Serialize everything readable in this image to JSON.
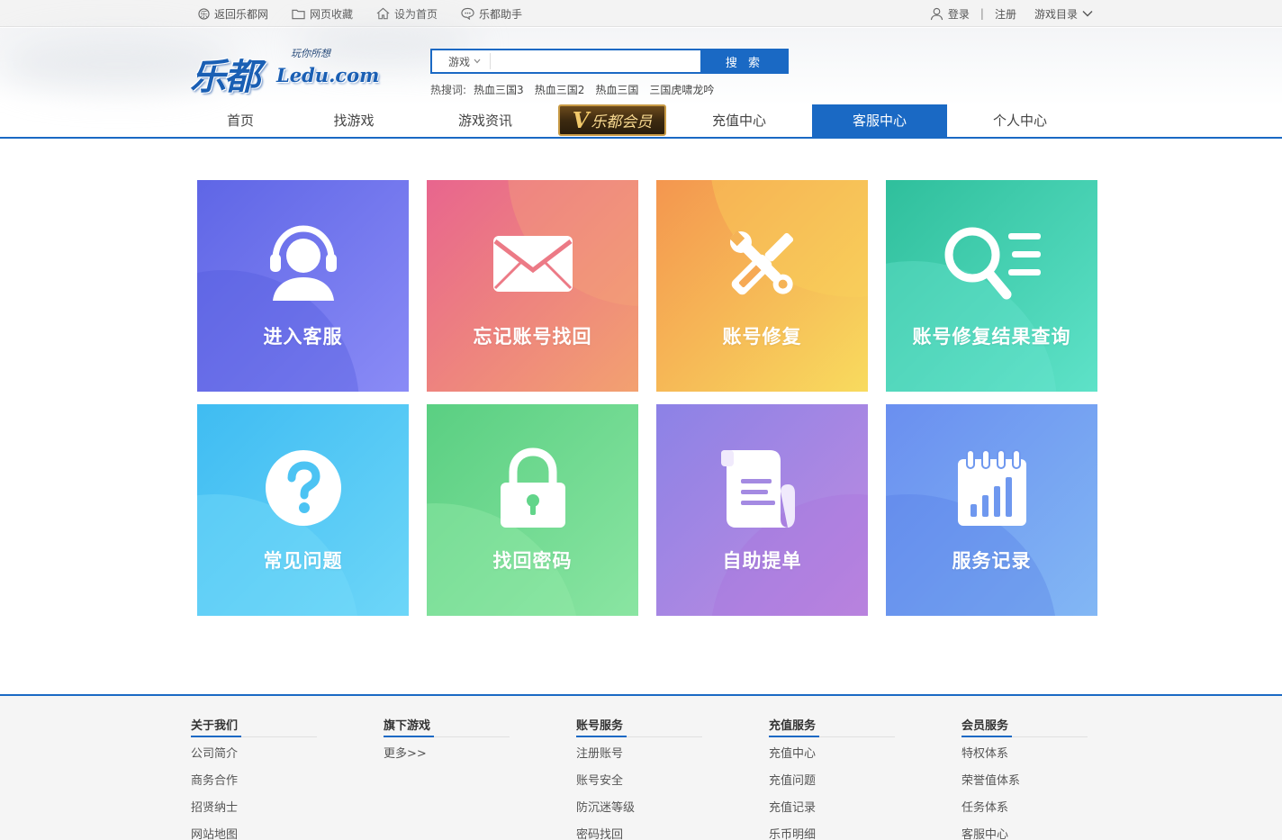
{
  "topbar": {
    "left_items": [
      {
        "label": "返回乐都网",
        "icon": "ledu-coin-icon"
      },
      {
        "label": "网页收藏",
        "icon": "folder-icon"
      },
      {
        "label": "设为首页",
        "icon": "home-icon"
      },
      {
        "label": "乐都助手",
        "icon": "chat-bubble-icon"
      }
    ],
    "login": "登录",
    "separator": "|",
    "register": "注册",
    "game_directory": "游戏目录"
  },
  "header": {
    "logo_cn": "乐都",
    "logo_en": "Ledu.com",
    "logo_slogan": "玩你所想"
  },
  "search": {
    "category": "游戏",
    "placeholder": "",
    "button_label": "搜 索",
    "hot_label": "热搜词:",
    "hot_words": [
      "热血三国3",
      "热血三国2",
      "热血三国",
      "三国虎啸龙吟"
    ]
  },
  "nav": {
    "items": [
      {
        "label": "首页"
      },
      {
        "label": "找游戏"
      },
      {
        "label": "游戏资讯"
      },
      {
        "label": "乐都会员",
        "vip_mark": "V"
      },
      {
        "label": "充值中心"
      },
      {
        "label": "客服中心",
        "active": true
      },
      {
        "label": "个人中心"
      }
    ],
    "accent": "#1a69c4"
  },
  "tiles": [
    {
      "label": "进入客服",
      "icon": "customer-service-headset-icon",
      "colors": [
        "#6a72ea",
        "#8b8cf6"
      ]
    },
    {
      "label": "忘记账号找回",
      "icon": "envelope-icon",
      "colors": [
        "#ea6f8f",
        "#f59b6f"
      ]
    },
    {
      "label": "账号修复",
      "icon": "tools-wrench-screwdriver-icon",
      "colors": [
        "#f6a35a",
        "#f8d35a"
      ]
    },
    {
      "label": "账号修复结果查询",
      "icon": "search-list-icon",
      "colors": [
        "#33c3a3",
        "#5fe0c6"
      ]
    },
    {
      "label": "常见问题",
      "icon": "question-circle-icon",
      "colors": [
        "#48c2f4",
        "#66d2f7"
      ]
    },
    {
      "label": "找回密码",
      "icon": "padlock-icon",
      "colors": [
        "#5fd48a",
        "#86e49e"
      ]
    },
    {
      "label": "自助提单",
      "icon": "scroll-document-icon",
      "colors": [
        "#9b83e8",
        "#c092e6"
      ]
    },
    {
      "label": "服务记录",
      "icon": "calendar-chart-icon",
      "colors": [
        "#5c8de8",
        "#7fb1f2"
      ]
    }
  ],
  "footer": {
    "columns": [
      {
        "title": "关于我们",
        "links": [
          "公司简介",
          "商务合作",
          "招贤纳士",
          "网站地图"
        ]
      },
      {
        "title": "旗下游戏",
        "links": [
          "更多>>"
        ]
      },
      {
        "title": "账号服务",
        "links": [
          "注册账号",
          "账号安全",
          "防沉迷等级",
          "密码找回"
        ]
      },
      {
        "title": "充值服务",
        "links": [
          "充值中心",
          "充值问题",
          "充值记录",
          "乐币明细"
        ]
      },
      {
        "title": "会员服务",
        "links": [
          "特权体系",
          "荣誉值体系",
          "任务体系",
          "客服中心"
        ]
      }
    ]
  }
}
